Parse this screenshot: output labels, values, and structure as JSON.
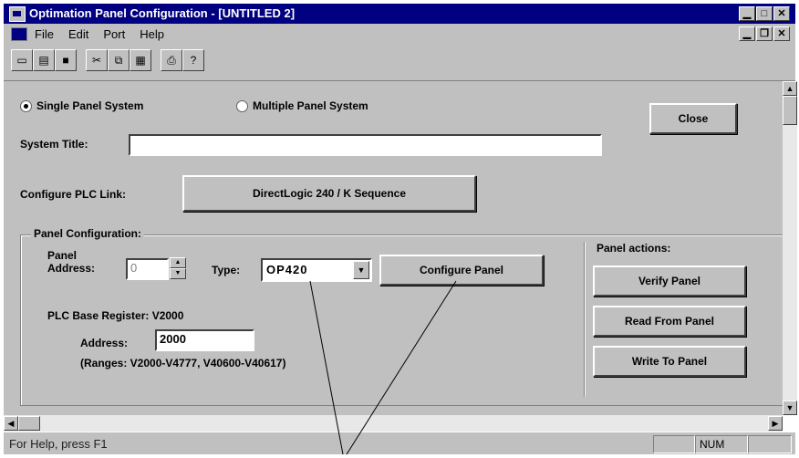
{
  "window": {
    "title": "Optimation Panel Configuration - [UNTITLED 2]"
  },
  "menu": [
    "File",
    "Edit",
    "Port",
    "Help"
  ],
  "toolbar": {
    "group1": [
      "new-icon",
      "open-icon",
      "save-icon"
    ],
    "group2": [
      "cut-icon",
      "copy-icon",
      "paste-icon"
    ],
    "group3": [
      "print-icon",
      "help-icon"
    ]
  },
  "system": {
    "single_label": "Single Panel System",
    "multiple_label": "Multiple Panel System",
    "selected": "single",
    "title_label": "System Title:",
    "title_value": ""
  },
  "close_label": "Close",
  "plc_link": {
    "label": "Configure PLC Link:",
    "button": "DirectLogic 240 / K Sequence"
  },
  "panel_config": {
    "legend": "Panel Configuration:",
    "address_label_1": "Panel",
    "address_label_2": "Address:",
    "address_value": "0",
    "type_label": "Type:",
    "type_value": "OP420",
    "configure_button": "Configure Panel",
    "base_register": "PLC Base Register: V2000",
    "reg_address_label": "Address:",
    "reg_address_value": "2000",
    "ranges": "(Ranges: V2000-V4777, V40600-V40617)"
  },
  "panel_actions": {
    "title": "Panel actions:",
    "verify": "Verify Panel",
    "read": "Read From Panel",
    "write": "Write To Panel"
  },
  "status": {
    "help": "For Help, press F1",
    "num": "NUM"
  }
}
